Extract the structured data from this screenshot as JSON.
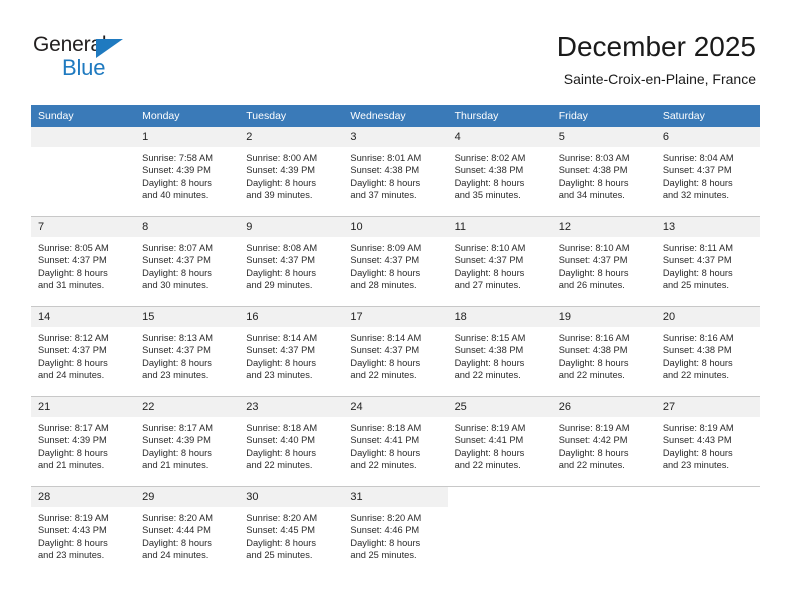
{
  "brand": {
    "name_part1": "General",
    "name_part2": "Blue",
    "triangle_icon": "triangle-icon"
  },
  "header": {
    "title": "December 2025",
    "subtitle": "Sainte-Croix-en-Plaine, France"
  },
  "colors": {
    "header_blue": "#3a7ab8",
    "brand_blue": "#1f7ac0",
    "daynum_band": "#f1f1f1",
    "row_divider": "#c8c8c8"
  },
  "weekdays": [
    "Sunday",
    "Monday",
    "Tuesday",
    "Wednesday",
    "Thursday",
    "Friday",
    "Saturday"
  ],
  "weeks": [
    [
      {
        "day": "",
        "sunrise": "",
        "sunset": "",
        "daylight1": "",
        "daylight2": "",
        "empty": true
      },
      {
        "day": "1",
        "sunrise": "Sunrise: 7:58 AM",
        "sunset": "Sunset: 4:39 PM",
        "daylight1": "Daylight: 8 hours",
        "daylight2": "and 40 minutes."
      },
      {
        "day": "2",
        "sunrise": "Sunrise: 8:00 AM",
        "sunset": "Sunset: 4:39 PM",
        "daylight1": "Daylight: 8 hours",
        "daylight2": "and 39 minutes."
      },
      {
        "day": "3",
        "sunrise": "Sunrise: 8:01 AM",
        "sunset": "Sunset: 4:38 PM",
        "daylight1": "Daylight: 8 hours",
        "daylight2": "and 37 minutes."
      },
      {
        "day": "4",
        "sunrise": "Sunrise: 8:02 AM",
        "sunset": "Sunset: 4:38 PM",
        "daylight1": "Daylight: 8 hours",
        "daylight2": "and 35 minutes."
      },
      {
        "day": "5",
        "sunrise": "Sunrise: 8:03 AM",
        "sunset": "Sunset: 4:38 PM",
        "daylight1": "Daylight: 8 hours",
        "daylight2": "and 34 minutes."
      },
      {
        "day": "6",
        "sunrise": "Sunrise: 8:04 AM",
        "sunset": "Sunset: 4:37 PM",
        "daylight1": "Daylight: 8 hours",
        "daylight2": "and 32 minutes."
      }
    ],
    [
      {
        "day": "7",
        "sunrise": "Sunrise: 8:05 AM",
        "sunset": "Sunset: 4:37 PM",
        "daylight1": "Daylight: 8 hours",
        "daylight2": "and 31 minutes."
      },
      {
        "day": "8",
        "sunrise": "Sunrise: 8:07 AM",
        "sunset": "Sunset: 4:37 PM",
        "daylight1": "Daylight: 8 hours",
        "daylight2": "and 30 minutes."
      },
      {
        "day": "9",
        "sunrise": "Sunrise: 8:08 AM",
        "sunset": "Sunset: 4:37 PM",
        "daylight1": "Daylight: 8 hours",
        "daylight2": "and 29 minutes."
      },
      {
        "day": "10",
        "sunrise": "Sunrise: 8:09 AM",
        "sunset": "Sunset: 4:37 PM",
        "daylight1": "Daylight: 8 hours",
        "daylight2": "and 28 minutes."
      },
      {
        "day": "11",
        "sunrise": "Sunrise: 8:10 AM",
        "sunset": "Sunset: 4:37 PM",
        "daylight1": "Daylight: 8 hours",
        "daylight2": "and 27 minutes."
      },
      {
        "day": "12",
        "sunrise": "Sunrise: 8:10 AM",
        "sunset": "Sunset: 4:37 PM",
        "daylight1": "Daylight: 8 hours",
        "daylight2": "and 26 minutes."
      },
      {
        "day": "13",
        "sunrise": "Sunrise: 8:11 AM",
        "sunset": "Sunset: 4:37 PM",
        "daylight1": "Daylight: 8 hours",
        "daylight2": "and 25 minutes."
      }
    ],
    [
      {
        "day": "14",
        "sunrise": "Sunrise: 8:12 AM",
        "sunset": "Sunset: 4:37 PM",
        "daylight1": "Daylight: 8 hours",
        "daylight2": "and 24 minutes."
      },
      {
        "day": "15",
        "sunrise": "Sunrise: 8:13 AM",
        "sunset": "Sunset: 4:37 PM",
        "daylight1": "Daylight: 8 hours",
        "daylight2": "and 23 minutes."
      },
      {
        "day": "16",
        "sunrise": "Sunrise: 8:14 AM",
        "sunset": "Sunset: 4:37 PM",
        "daylight1": "Daylight: 8 hours",
        "daylight2": "and 23 minutes."
      },
      {
        "day": "17",
        "sunrise": "Sunrise: 8:14 AM",
        "sunset": "Sunset: 4:37 PM",
        "daylight1": "Daylight: 8 hours",
        "daylight2": "and 22 minutes."
      },
      {
        "day": "18",
        "sunrise": "Sunrise: 8:15 AM",
        "sunset": "Sunset: 4:38 PM",
        "daylight1": "Daylight: 8 hours",
        "daylight2": "and 22 minutes."
      },
      {
        "day": "19",
        "sunrise": "Sunrise: 8:16 AM",
        "sunset": "Sunset: 4:38 PM",
        "daylight1": "Daylight: 8 hours",
        "daylight2": "and 22 minutes."
      },
      {
        "day": "20",
        "sunrise": "Sunrise: 8:16 AM",
        "sunset": "Sunset: 4:38 PM",
        "daylight1": "Daylight: 8 hours",
        "daylight2": "and 22 minutes."
      }
    ],
    [
      {
        "day": "21",
        "sunrise": "Sunrise: 8:17 AM",
        "sunset": "Sunset: 4:39 PM",
        "daylight1": "Daylight: 8 hours",
        "daylight2": "and 21 minutes."
      },
      {
        "day": "22",
        "sunrise": "Sunrise: 8:17 AM",
        "sunset": "Sunset: 4:39 PM",
        "daylight1": "Daylight: 8 hours",
        "daylight2": "and 21 minutes."
      },
      {
        "day": "23",
        "sunrise": "Sunrise: 8:18 AM",
        "sunset": "Sunset: 4:40 PM",
        "daylight1": "Daylight: 8 hours",
        "daylight2": "and 22 minutes."
      },
      {
        "day": "24",
        "sunrise": "Sunrise: 8:18 AM",
        "sunset": "Sunset: 4:41 PM",
        "daylight1": "Daylight: 8 hours",
        "daylight2": "and 22 minutes."
      },
      {
        "day": "25",
        "sunrise": "Sunrise: 8:19 AM",
        "sunset": "Sunset: 4:41 PM",
        "daylight1": "Daylight: 8 hours",
        "daylight2": "and 22 minutes."
      },
      {
        "day": "26",
        "sunrise": "Sunrise: 8:19 AM",
        "sunset": "Sunset: 4:42 PM",
        "daylight1": "Daylight: 8 hours",
        "daylight2": "and 22 minutes."
      },
      {
        "day": "27",
        "sunrise": "Sunrise: 8:19 AM",
        "sunset": "Sunset: 4:43 PM",
        "daylight1": "Daylight: 8 hours",
        "daylight2": "and 23 minutes."
      }
    ],
    [
      {
        "day": "28",
        "sunrise": "Sunrise: 8:19 AM",
        "sunset": "Sunset: 4:43 PM",
        "daylight1": "Daylight: 8 hours",
        "daylight2": "and 23 minutes."
      },
      {
        "day": "29",
        "sunrise": "Sunrise: 8:20 AM",
        "sunset": "Sunset: 4:44 PM",
        "daylight1": "Daylight: 8 hours",
        "daylight2": "and 24 minutes."
      },
      {
        "day": "30",
        "sunrise": "Sunrise: 8:20 AM",
        "sunset": "Sunset: 4:45 PM",
        "daylight1": "Daylight: 8 hours",
        "daylight2": "and 25 minutes."
      },
      {
        "day": "31",
        "sunrise": "Sunrise: 8:20 AM",
        "sunset": "Sunset: 4:46 PM",
        "daylight1": "Daylight: 8 hours",
        "daylight2": "and 25 minutes."
      },
      {
        "day": "",
        "sunrise": "",
        "sunset": "",
        "daylight1": "",
        "daylight2": "",
        "blank": true
      },
      {
        "day": "",
        "sunrise": "",
        "sunset": "",
        "daylight1": "",
        "daylight2": "",
        "blank": true
      },
      {
        "day": "",
        "sunrise": "",
        "sunset": "",
        "daylight1": "",
        "daylight2": "",
        "blank": true
      }
    ]
  ]
}
